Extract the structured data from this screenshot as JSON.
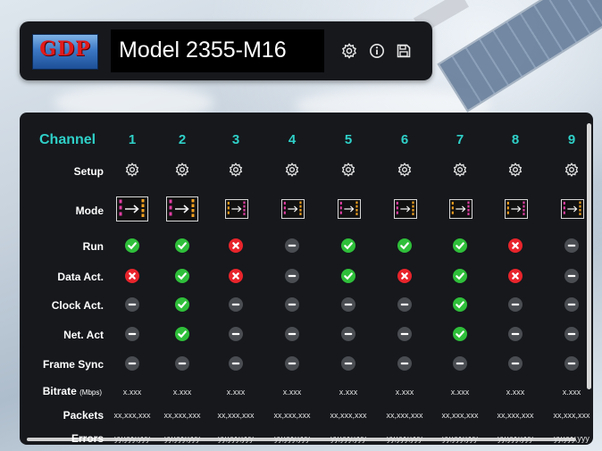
{
  "header": {
    "logo_text": "GDP",
    "model": "Model 2355-M16",
    "icons": [
      "gear-icon",
      "info-icon",
      "save-icon"
    ]
  },
  "table": {
    "channel_label": "Channel",
    "channels": [
      "1",
      "2",
      "3",
      "4",
      "5",
      "6",
      "7",
      "8",
      "9"
    ],
    "rows": {
      "setup": "Setup",
      "mode": "Mode",
      "run": "Run",
      "data_act": "Data Act.",
      "clock_act": "Clock Act.",
      "net_act": "Net. Act",
      "frame_sync": "Frame Sync",
      "bitrate": "Bitrate",
      "bitrate_unit": "(Mbps)",
      "packets": "Packets",
      "errors": "Errors"
    },
    "mode_icons": [
      "pcm-to-enet",
      "pcm-to-enet",
      "enet-to-pcm",
      "pcm-to-enet",
      "pcm-to-enet",
      "pcm-to-enet",
      "enet-to-pcm",
      "enet-to-pcm",
      "pcm-to-enet"
    ],
    "status": {
      "run": [
        "ok",
        "ok",
        "err",
        "idle",
        "ok",
        "ok",
        "ok",
        "err",
        "idle"
      ],
      "data_act": [
        "err",
        "ok",
        "err",
        "idle",
        "ok",
        "err",
        "ok",
        "err",
        "idle"
      ],
      "clock_act": [
        "idle",
        "ok",
        "idle",
        "idle",
        "idle",
        "idle",
        "ok",
        "idle",
        "idle"
      ],
      "net_act": [
        "idle",
        "ok",
        "idle",
        "idle",
        "idle",
        "idle",
        "ok",
        "idle",
        "idle"
      ],
      "frame_sync": [
        "idle",
        "idle",
        "idle",
        "idle",
        "idle",
        "idle",
        "idle",
        "idle",
        "idle"
      ]
    },
    "bitrate_values": [
      "x.xxx",
      "x.xxx",
      "x.xxx",
      "x.xxx",
      "x.xxx",
      "x.xxx",
      "x.xxx",
      "x.xxx",
      "x.xxx"
    ],
    "packet_values": [
      "xx,xxx,xxx",
      "xx,xxx,xxx",
      "xx,xxx,xxx",
      "xx,xxx,xxx",
      "xx,xxx,xxx",
      "xx,xxx,xxx",
      "xx,xxx,xxx",
      "xx,xxx,xxx",
      "xx,xxx,xxx"
    ],
    "error_values": [
      "yy,yyy,yyy",
      "yy,yyy,yyy",
      "yy,yyy,yyy",
      "yy,yyy,yyy",
      "yy,yyy,yyy",
      "yy,yyy,yyy",
      "yy,yyy,yyy",
      "yy,yyy,yyy",
      "yy,yyy,yyy"
    ]
  },
  "colors": {
    "accent": "#2fd0c8",
    "ok": "#2fbf3a",
    "error": "#e8242b",
    "idle": "#4a4d52",
    "panel": "#16181c",
    "mode_pcm": "#e23fa5",
    "mode_enet": "#f0a020"
  }
}
